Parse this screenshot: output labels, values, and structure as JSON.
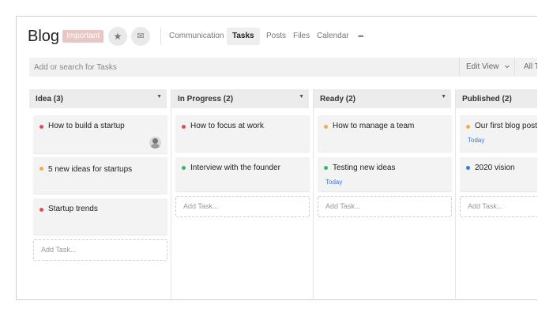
{
  "header": {
    "title": "Blog",
    "badge": "Important",
    "star_icon": "★",
    "mail_icon": "✉",
    "tabs": [
      {
        "label": "Communication",
        "active": false
      },
      {
        "label": "Tasks",
        "active": true
      },
      {
        "label": "Posts",
        "active": false
      },
      {
        "label": "Files",
        "active": false
      },
      {
        "label": "Calendar",
        "active": false
      }
    ],
    "more_icon": "•••"
  },
  "search": {
    "placeholder": "Add or search for Tasks",
    "edit_view_label": "Edit View",
    "edit_view_icon": "chevron-down-icon",
    "all_tasks_label": "All Tasks"
  },
  "colors": {
    "red": "#d9534f",
    "orange": "#f0ad4e",
    "green": "#3cb371",
    "blue": "#3a7bd5"
  },
  "columns": [
    {
      "title": "Idea (3)",
      "cards": [
        {
          "text": "How to build a startup",
          "dot": "red",
          "avatar": true
        },
        {
          "text": "5 new ideas for startups",
          "dot": "orange"
        },
        {
          "text": "Startup trends",
          "dot": "red"
        }
      ],
      "add_label": "Add Task..."
    },
    {
      "title": "In Progress (2)",
      "cards": [
        {
          "text": "How to focus at work",
          "dot": "red"
        },
        {
          "text": "Interview with the founder",
          "dot": "green"
        }
      ],
      "add_label": "Add Task..."
    },
    {
      "title": "Ready (2)",
      "cards": [
        {
          "text": "How to manage a team",
          "dot": "orange"
        },
        {
          "text": "Testing new ideas",
          "dot": "green",
          "date": "Today"
        }
      ],
      "add_label": "Add Task..."
    },
    {
      "title": "Published (2)",
      "cards": [
        {
          "text": "Our first blog post",
          "dot": "orange",
          "date": "Today"
        },
        {
          "text": "2020 vision",
          "dot": "blue"
        }
      ],
      "add_label": "Add Task..."
    }
  ]
}
